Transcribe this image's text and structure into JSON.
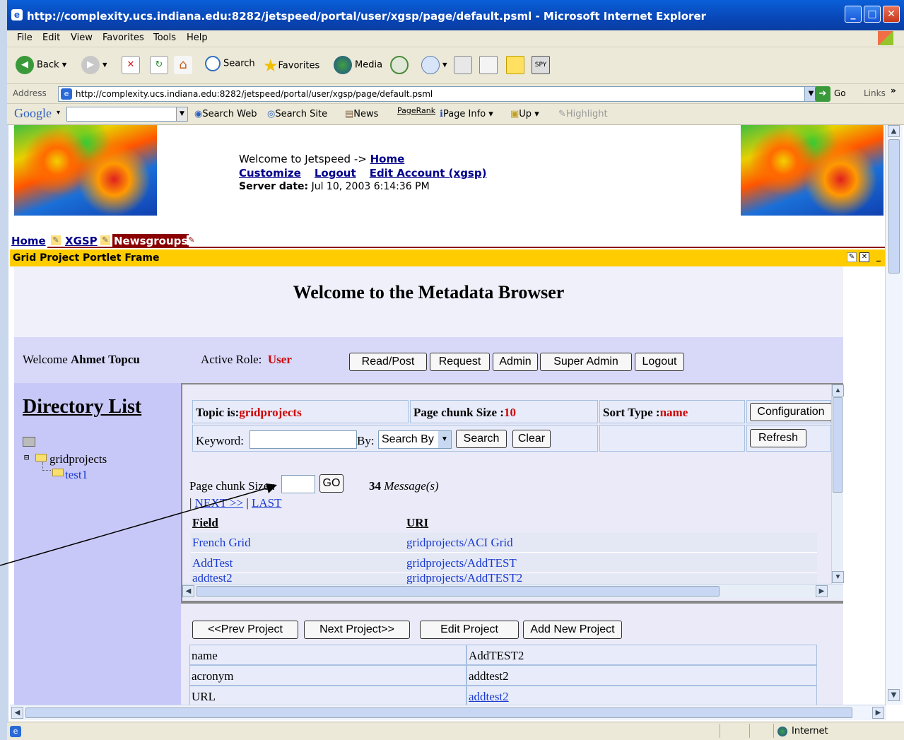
{
  "window": {
    "title": "http://complexity.ucs.indiana.edu:8282/jetspeed/portal/user/xgsp/page/default.psml - Microsoft Internet Explorer"
  },
  "menu": [
    "File",
    "Edit",
    "View",
    "Favorites",
    "Tools",
    "Help"
  ],
  "toolbar": {
    "back": "Back",
    "search": "Search",
    "favorites": "Favorites",
    "media": "Media"
  },
  "address": {
    "label": "Address",
    "url": "http://complexity.ucs.indiana.edu:8282/jetspeed/portal/user/xgsp/page/default.psml",
    "go": "Go",
    "links": "Links"
  },
  "google": {
    "logo": "Google",
    "search_web": "Search Web",
    "search_site": "Search Site",
    "news": "News",
    "pagerank": "PageRank",
    "page_info": "Page Info",
    "up": "Up",
    "highlight": "Highlight"
  },
  "header": {
    "welcome": "Welcome to Jetspeed ->",
    "home": "Home",
    "customize": "Customize",
    "logout": "Logout",
    "edit_account": "Edit Account (xgsp)",
    "server_date_label": "Server date:",
    "server_date": "Jul 10, 2003 6:14:36 PM"
  },
  "tabs": [
    "Home",
    "XGSP",
    "Newsgroups"
  ],
  "portlet": {
    "title": "Grid Project Portlet Frame",
    "heading": "Welcome to the Metadata Browser",
    "welcome_label": "Welcome",
    "user_name": "Ahmet Topcu",
    "active_role_label": "Active Role:",
    "active_role": "User",
    "role_buttons": [
      "Read/Post",
      "Request",
      "Admin",
      "Super Admin",
      "Logout"
    ]
  },
  "directory": {
    "title": "Directory List",
    "root": "gridprojects",
    "child": "test1"
  },
  "browser": {
    "topic_label": "Topic is:",
    "topic": "gridprojects",
    "chunk_label": "Page chunk Size :",
    "chunk": "10",
    "sort_label": "Sort Type :",
    "sort": "name",
    "configuration": "Configuration",
    "keyword_label": "Keyword:",
    "by_label": "By:",
    "search_by": "Search By",
    "search": "Search",
    "clear": "Clear",
    "refresh": "Refresh",
    "page_chunk_label": "Page chunk Size :",
    "go": "GO",
    "message_count": "34",
    "message_label": "Message(s)",
    "next": "NEXT >>",
    "last": "LAST",
    "col_field": "Field",
    "col_uri": "URI",
    "rows": [
      {
        "field": "French Grid",
        "uri": "gridprojects/ACI Grid"
      },
      {
        "field": "AddTest",
        "uri": "gridprojects/AddTEST"
      },
      {
        "field": "addtest2",
        "uri": "gridprojects/AddTEST2"
      }
    ]
  },
  "project": {
    "prev": "<<Prev Project",
    "next": "Next Project>>",
    "edit": "Edit Project",
    "add": "Add New Project",
    "rows": [
      {
        "key": "name",
        "value": "AddTEST2"
      },
      {
        "key": "acronym",
        "value": "addtest2"
      },
      {
        "key": "URL",
        "value": "addtest2"
      }
    ]
  },
  "status": {
    "zone": "Internet"
  }
}
